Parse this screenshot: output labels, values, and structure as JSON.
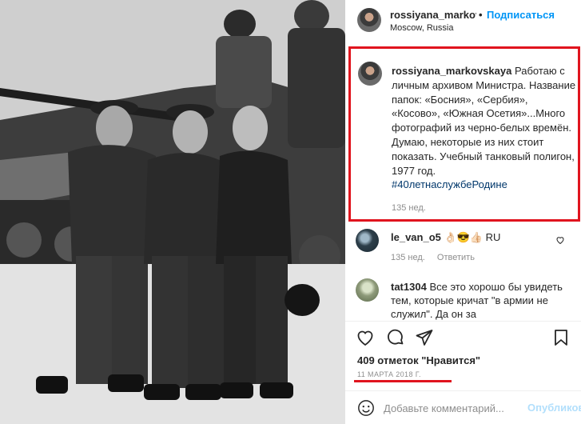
{
  "post": {
    "username": "rossiyana_markovskaya",
    "username_truncated": "rossiyana_markovs",
    "separator": "•",
    "follow_label": "Подписаться",
    "location": "Moscow, Russia",
    "caption_text": "Работаю с личным архивом Министра. Название папок: «Босния», «Сербия», «Косово», «Южная Осетия»...Много фотографий из черно-белых времён. Думаю, некоторые из них стоит показать. Учебный танковый полигон, 1977 год.",
    "hashtag": "#40летнаслужбеРодине",
    "caption_time": "135 нед."
  },
  "comments": [
    {
      "username": "le_van_o5",
      "text": "👌🏻😎👍🏻 RU",
      "time": "135 нед.",
      "reply_label": "Ответить"
    },
    {
      "username": "tat1304",
      "text": "Все это хорошо бы увидеть тем, которые кричат \"в армии не служил\". Да он за"
    }
  ],
  "actions": {
    "like_icon": "heart-icon",
    "comment_icon": "comment-icon",
    "share_icon": "share-icon",
    "save_icon": "bookmark-icon"
  },
  "likes_text": "409 отметок \"Нравится\"",
  "date_text": "11 МАРТА 2018 Г.",
  "add_comment": {
    "placeholder": "Добавьте комментарий...",
    "publish_label": "Опубликовать"
  },
  "colors": {
    "accent_blue": "#0095f6",
    "highlight_red": "#e0141e",
    "muted": "#8e8e8e"
  }
}
